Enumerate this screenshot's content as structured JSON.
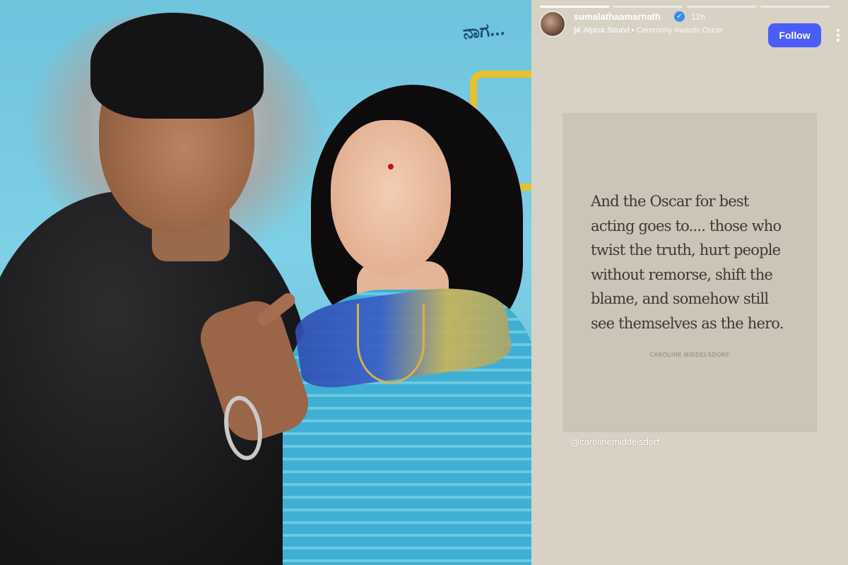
{
  "story": {
    "username": "sumalathaamarnath",
    "verified_glyph": "✓",
    "time_ago": "12h",
    "audio": {
      "icon": "audio-bars-icon",
      "artist": "Alpina Sound",
      "separator": "•",
      "song": "Ceremony Awards Oscar"
    },
    "follow_label": "Follow",
    "more_icon": "more-vertical-icon",
    "progress": {
      "segments": 4,
      "current": 1
    }
  },
  "quote": {
    "text_lines": [
      "And the Oscar for best",
      "acting goes to.... those who",
      "twist the truth, hurt people",
      "without remorse, shift the",
      "blame, and somehow still",
      "see themselves as the hero."
    ],
    "author": "CAROLINE MIDDELSDORF"
  },
  "mention": "@carolinemiddelsdorf",
  "photo": {
    "poster_text": "ನಾಗ..."
  },
  "colors": {
    "follow_button": "#4a5df9",
    "story_background": "#d8d2c5",
    "quote_card": "#cbc4b7",
    "quote_text": "#3f3833"
  }
}
